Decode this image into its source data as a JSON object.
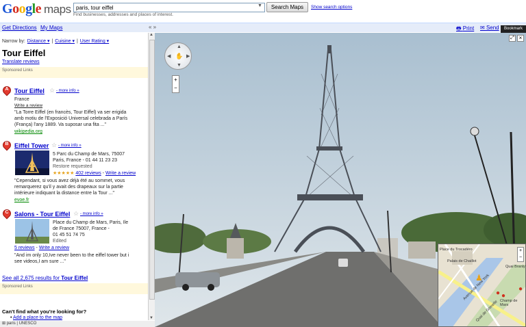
{
  "header": {
    "logo_google": [
      "G",
      "o",
      "o",
      "g",
      "l",
      "e"
    ],
    "logo_maps": "maps",
    "search_value": "paris, tour eiffel",
    "search_hint": "Find businesses, addresses and places of interest.",
    "search_button": "Search Maps",
    "show_options": "Show search options"
  },
  "toolbar": {
    "get_directions": "Get Directions",
    "my_maps": "My Maps",
    "collapse": "« »",
    "print": "Print",
    "send": "Send",
    "link": "Bookmark"
  },
  "sidebar": {
    "narrow_label": "Narrow by:",
    "filters": [
      "Distance ▾",
      "Cuisine ▾",
      "User Rating ▾"
    ],
    "place_title": "Tour Eiffel",
    "translate": "Translate reviews",
    "sponsored": "Sponsored Links",
    "results": [
      {
        "letter": "A",
        "title": "Tour Eiffel",
        "more_info": "- more info »",
        "lines": [
          "France",
          "Write a review",
          "\"La Torre Eiffel (en francès, Tour Eiffel) va ser erigida",
          "amb motiu de l'Exposició Universal celebrada a París",
          "(França) l'any 1889. Va suposar una fita ...\""
        ],
        "source": "wikipedia.org"
      },
      {
        "letter": "B",
        "title": "Eiffel Tower",
        "more_info": "- more info »",
        "lines": [
          "5 Parc du Champ de Mars, 75007",
          "Paris, France - 01 44 11 23 23",
          "Restore requested"
        ],
        "reviews": "402 reviews",
        "write_review": "Write a review",
        "quote": [
          "\"Cependant, si vous avez déjà été au sommet, vous",
          "remarquerez qu'il y avait des drapeaux sur la partie",
          "intérieure indiquant la distance entre la Tour ...\""
        ],
        "source": "evoe.fr"
      },
      {
        "letter": "C",
        "title": "Salons - Tour Eiffel",
        "more_info": "- more info »",
        "lines": [
          "Place du Champ de Mars, Paris, Ile",
          "de France 75007, France -",
          "01 45 51 74 75",
          "Edited"
        ],
        "reviews": "5 reviews",
        "write_review": "Write a review",
        "quote": [
          "\"And im only 10,Ive never been to the eiffel tower but i",
          "see videos,I am sure ...\""
        ]
      }
    ],
    "see_all_prefix": "See all 2,675 results for ",
    "see_all_term": "Tour Eiffel",
    "cant_find": "Can't find what you're looking for?",
    "add_place": "Add a place to the map",
    "footer": "paris | UNESCO"
  },
  "minimap": {
    "labels": [
      "Palais de Chaillot",
      "Quai Branly",
      "Avenue de New York",
      "Quai de Grenelle",
      "Place du Trocadéro",
      "Champ de Mars"
    ]
  },
  "colors": {
    "accent": "#1a55d6",
    "link": "#0000cc",
    "toolbar_bg": "#e5ecf9",
    "sponsored_bg": "#fff8dc"
  }
}
